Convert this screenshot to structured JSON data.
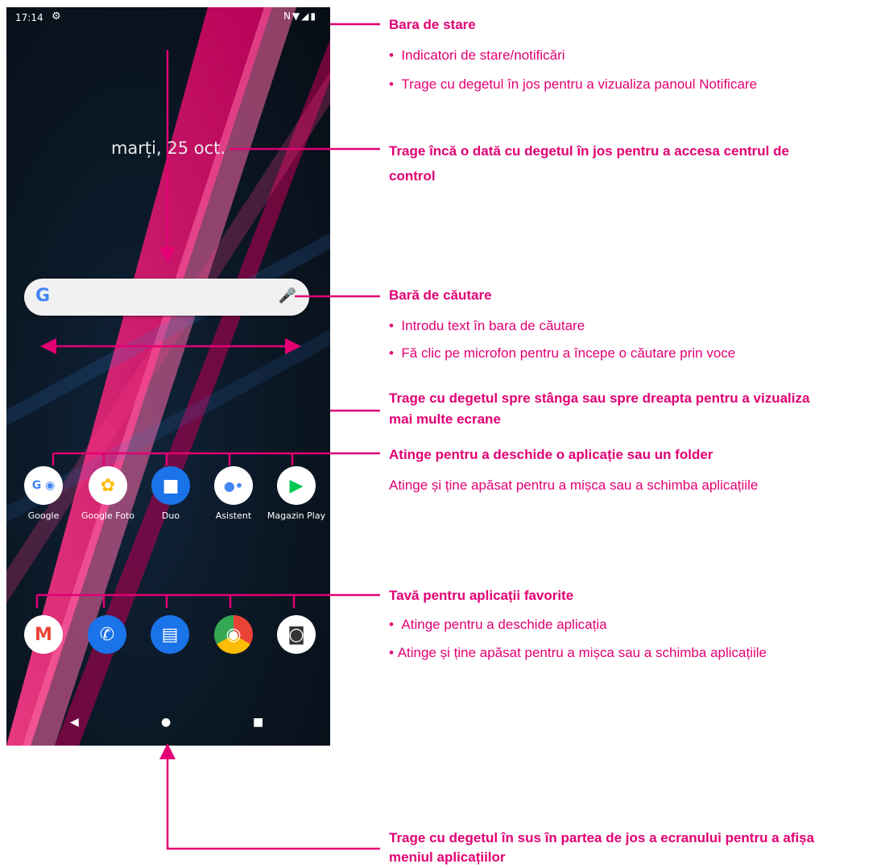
{
  "phone": {
    "status_bar": {
      "time": "17:14",
      "settings_icon": "gear-icon",
      "right_icons": [
        "nfc-icon",
        "wifi-icon",
        "signal-icon",
        "battery-icon"
      ]
    },
    "date": "marți, 25 oct.",
    "search_bar": {
      "logo": "G",
      "icons": [
        "google-g-icon",
        "microphone-icon"
      ]
    },
    "apps": [
      {
        "label": "Google",
        "icon": "google-folder-icon"
      },
      {
        "label": "Google Foto",
        "icon": "photos-icon"
      },
      {
        "label": "Duo",
        "icon": "video-camera-icon"
      },
      {
        "label": "Asistent",
        "icon": "assistant-icon"
      },
      {
        "label": "Magazin Play",
        "icon": "play-store-icon"
      }
    ],
    "dock": [
      {
        "icon": "gmail-icon"
      },
      {
        "icon": "phone-icon"
      },
      {
        "icon": "messages-icon"
      },
      {
        "icon": "chrome-icon"
      },
      {
        "icon": "camera-icon"
      }
    ],
    "nav": [
      "back-icon",
      "home-icon",
      "recents-icon"
    ]
  },
  "annotations": {
    "status_bar_title": "Bara de stare",
    "status_bar_b1": "Indicatori de stare/notificări",
    "status_bar_b2": "Trage cu degetul în jos pentru a vizualiza panoul Notificare",
    "control_center_l1": "Trage încă o dată cu degetul în jos pentru a accesa centrul de",
    "control_center_l2": "control",
    "search_title": "Bară de căutare",
    "search_b1": "Introdu text în bara de căutare",
    "search_b2": "Fă clic pe microfon pentru a începe o căutare prin voce",
    "swipe_l1": "Trage cu degetul spre stânga sau spre dreapta pentru a vizualiza",
    "swipe_l2": "mai multe ecrane",
    "tap_title": "Atinge pentru a deschide o aplicație sau un folder",
    "tap_sub": "Atinge și ține apăsat pentru a mișca sau a schimba aplicațiile",
    "tray_title": "Tavă pentru aplicații favorite",
    "tray_b1": "Atinge pentru a deschide aplicația",
    "tray_b2": "Atinge și ține apăsat pentru a mișca sau a schimba aplicațiile",
    "app_menu_l1": "Trage cu degetul în sus în partea de jos a ecranului pentru a afișa",
    "app_menu_l2": "meniul aplicațiilor",
    "bullet": "•"
  },
  "colors": {
    "accent": "#e20074",
    "wallpaper_streak": "#ff1f7a"
  }
}
